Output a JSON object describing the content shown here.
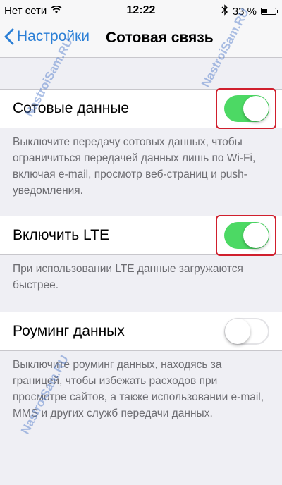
{
  "status_bar": {
    "carrier": "Нет сети",
    "time": "12:22",
    "battery": "33 %"
  },
  "nav": {
    "back_label": "Настройки",
    "title": "Сотовая связь"
  },
  "settings": [
    {
      "label": "Сотовые данные",
      "state": "on",
      "footer": "Выключите передачу сотовых данных, чтобы ограничиться передачей данных лишь по Wi-Fi, включая e-mail, просмотр веб-страниц и push-уведомления."
    },
    {
      "label": "Включить LTE",
      "state": "on",
      "footer": "При использовании LTE данные загружаются быстрее."
    },
    {
      "label": "Роуминг данных",
      "state": "off",
      "footer": "Выключите роуминг данных, находясь за границей, чтобы избежать расходов при просмотре сайтов, а также использовании e-mail, MMS и других служб передачи данных."
    }
  ],
  "watermarks": [
    "NastroiSam.RU",
    "NastroiSam.RU",
    "NastroiSam.RU"
  ],
  "colors": {
    "accent": "#2b7fd6",
    "toggle_on": "#4cd964",
    "highlight": "#d01f2d",
    "background": "#efeff4"
  },
  "icons": {
    "wifi": "wifi-icon",
    "bluetooth": "bluetooth-icon",
    "battery": "battery-icon",
    "back": "chevron-left-icon"
  }
}
